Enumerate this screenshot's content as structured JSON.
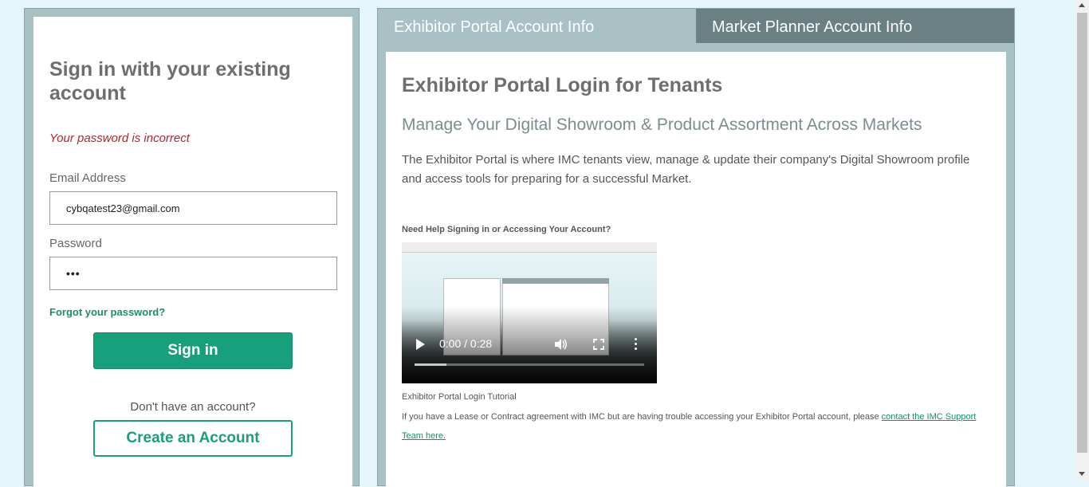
{
  "signin": {
    "heading": "Sign in with your existing account",
    "error": "Your password is incorrect",
    "email_label": "Email Address",
    "email_value": "cybqatest23@gmail.com",
    "password_label": "Password",
    "password_value": "•••",
    "forgot_link": "Forgot your password?",
    "signin_button": "Sign in",
    "no_account_text": "Don't have an account?",
    "create_button": "Create an Account"
  },
  "tabs": [
    {
      "label": "Exhibitor Portal Account Info",
      "active": true
    },
    {
      "label": "Market Planner Account Info",
      "active": false
    }
  ],
  "portal": {
    "title": "Exhibitor Portal Login for Tenants",
    "subtitle": "Manage Your Digital Showroom & Product Assortment Across Markets",
    "description": "The Exhibitor Portal is where IMC tenants view, manage & update their company's Digital Showroom profile and access tools for preparing for a successful Market.",
    "help_heading": "Need Help Signing in or Accessing Your Account?",
    "video": {
      "time": "0:00 / 0:28",
      "progress_fraction": 0.14
    },
    "video_caption": "Exhibitor Portal Login Tutorial",
    "support_text": "If you have a Lease or Contract agreement with IMC but are having trouble accessing your Exhibitor Portal account, please ",
    "support_link": "contact the IMC Support Team here."
  },
  "colors": {
    "accent_green": "#18a07c",
    "error_red": "#b0282d",
    "panel_border": "#a9c0c5",
    "inactive_tab": "#6b8083"
  }
}
